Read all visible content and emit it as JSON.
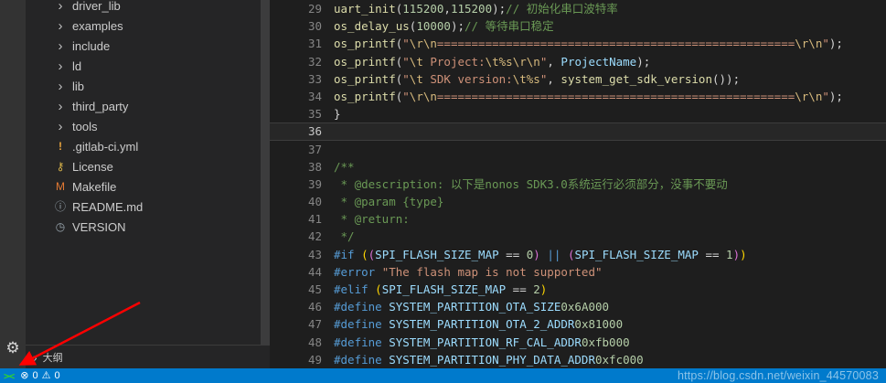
{
  "colors": {
    "statusbar_accent": "#007acc",
    "annotation_arrow": "#ff0000",
    "sidebar_bg": "#252526",
    "editor_bg": "#1e1e1e"
  },
  "icons": {
    "gear": "⚙",
    "chevron": "›"
  },
  "sidebar": {
    "outline_label": "大纲",
    "items": [
      {
        "label": "driver_lib",
        "kind": "folder",
        "icon": "›",
        "icon_name": "chevron-right-icon",
        "icon_color": "#bfbfbf"
      },
      {
        "label": "examples",
        "kind": "folder",
        "icon": "›",
        "icon_name": "chevron-right-icon",
        "icon_color": "#bfbfbf"
      },
      {
        "label": "include",
        "kind": "folder",
        "icon": "›",
        "icon_name": "chevron-right-icon",
        "icon_color": "#bfbfbf"
      },
      {
        "label": "ld",
        "kind": "folder",
        "icon": "›",
        "icon_name": "chevron-right-icon",
        "icon_color": "#bfbfbf"
      },
      {
        "label": "lib",
        "kind": "folder",
        "icon": "›",
        "icon_name": "chevron-right-icon",
        "icon_color": "#bfbfbf"
      },
      {
        "label": "third_party",
        "kind": "folder",
        "icon": "›",
        "icon_name": "chevron-right-icon",
        "icon_color": "#bfbfbf"
      },
      {
        "label": "tools",
        "kind": "folder",
        "icon": "›",
        "icon_name": "chevron-right-icon",
        "icon_color": "#bfbfbf"
      },
      {
        "label": ".gitlab-ci.yml",
        "kind": "file",
        "icon": "!",
        "icon_name": "gitlab-icon",
        "icon_color": "#e8a33d"
      },
      {
        "label": "License",
        "kind": "file",
        "icon": "⚷",
        "icon_name": "license-icon",
        "icon_color": "#d9b44a"
      },
      {
        "label": "Makefile",
        "kind": "file",
        "icon": "M",
        "icon_name": "makefile-icon",
        "icon_color": "#e37933"
      },
      {
        "label": "README.md",
        "kind": "file",
        "icon": "ⓘ",
        "icon_name": "readme-info-icon",
        "icon_color": "#9aa7b0"
      },
      {
        "label": "VERSION",
        "kind": "file",
        "icon": "◷",
        "icon_name": "version-clock-icon",
        "icon_color": "#9aa7b0"
      }
    ]
  },
  "editor": {
    "lines": [
      {
        "num": "29",
        "tokens": [
          {
            "pad": 8
          },
          [
            "uart_init",
            "fn"
          ],
          [
            "(",
            "d"
          ],
          [
            "115200",
            "n"
          ],
          [
            ",",
            "d"
          ],
          [
            "115200",
            "n"
          ],
          [
            ");",
            "d"
          ],
          {
            "pad": 2
          },
          [
            "// 初始化串口波特率",
            "c"
          ]
        ]
      },
      {
        "num": "30",
        "tokens": [
          {
            "pad": 4
          },
          [
            "os_delay_us",
            "fn"
          ],
          [
            "(",
            "d"
          ],
          [
            "10000",
            "n"
          ],
          [
            ");",
            "d"
          ],
          {
            "pad": 11
          },
          [
            "// 等待串口稳定",
            "c"
          ]
        ]
      },
      {
        "num": "31",
        "tokens": [
          {
            "pad": 4
          },
          [
            "os_printf",
            "fn"
          ],
          [
            "(",
            "d"
          ],
          [
            "\"",
            "s"
          ],
          [
            "\\r\\n",
            "e"
          ],
          {
            "rep": "=",
            "n": 52,
            "c": "s"
          },
          [
            "\\r\\n",
            "e"
          ],
          [
            "\"",
            "s"
          ],
          [
            ");",
            "d"
          ]
        ]
      },
      {
        "num": "32",
        "tokens": [
          {
            "pad": 4
          },
          [
            "os_printf",
            "fn"
          ],
          [
            "(",
            "d"
          ],
          [
            "\"",
            "s"
          ],
          [
            "\\t",
            "e"
          ],
          [
            " Project:",
            "s"
          ],
          [
            "\\t",
            "e"
          ],
          [
            "%s",
            "e"
          ],
          [
            "\\r\\n",
            "e"
          ],
          [
            "\"",
            "s"
          ],
          [
            ", ",
            "d"
          ],
          [
            "ProjectName",
            "m"
          ],
          [
            ");",
            "d"
          ]
        ]
      },
      {
        "num": "33",
        "tokens": [
          {
            "pad": 4
          },
          [
            "os_printf",
            "fn"
          ],
          [
            "(",
            "d"
          ],
          [
            "\"",
            "s"
          ],
          [
            "\\t",
            "e"
          ],
          [
            " SDK version:",
            "s"
          ],
          [
            "\\t",
            "e"
          ],
          [
            "%s",
            "e"
          ],
          [
            "\"",
            "s"
          ],
          [
            ", ",
            "d"
          ],
          [
            "system_get_sdk_version",
            "fn"
          ],
          [
            "());",
            "d"
          ]
        ]
      },
      {
        "num": "34",
        "tokens": [
          {
            "pad": 4
          },
          [
            "os_printf",
            "fn"
          ],
          [
            "(",
            "d"
          ],
          [
            "\"",
            "s"
          ],
          [
            "\\r\\n",
            "e"
          ],
          {
            "rep": "=",
            "n": 52,
            "c": "s"
          },
          [
            "\\r\\n",
            "e"
          ],
          [
            "\"",
            "s"
          ],
          [
            ");",
            "d"
          ]
        ]
      },
      {
        "num": "35",
        "tokens": [
          [
            "}",
            "d"
          ]
        ]
      },
      {
        "num": "36",
        "current": true,
        "tokens": []
      },
      {
        "num": "37",
        "tokens": []
      },
      {
        "num": "38",
        "tokens": [
          [
            "/**",
            "c"
          ]
        ]
      },
      {
        "num": "39",
        "tokens": [
          [
            " * @description: 以下是nonos SDK3.0系统运行必须部分，没事不要动",
            "c"
          ]
        ]
      },
      {
        "num": "40",
        "tokens": [
          [
            " * @param {type}",
            "c"
          ]
        ]
      },
      {
        "num": "41",
        "tokens": [
          [
            " * @return:",
            "c"
          ]
        ]
      },
      {
        "num": "42",
        "tokens": [
          [
            " */",
            "c"
          ]
        ]
      },
      {
        "num": "43",
        "tokens": [
          [
            "#if ",
            "p"
          ],
          [
            "(",
            "b1"
          ],
          [
            "(",
            "b2"
          ],
          [
            "SPI_FLASH_SIZE_MAP",
            "m"
          ],
          [
            " == ",
            "d"
          ],
          [
            "0",
            "n"
          ],
          [
            ")",
            "b2"
          ],
          [
            " ",
            "d"
          ],
          [
            "||",
            "p"
          ],
          [
            " ",
            "d"
          ],
          [
            "(",
            "b2"
          ],
          [
            "SPI_FLASH_SIZE_MAP",
            "m"
          ],
          [
            " == ",
            "d"
          ],
          [
            "1",
            "n"
          ],
          [
            ")",
            "b2"
          ],
          [
            ")",
            "b1"
          ]
        ]
      },
      {
        "num": "44",
        "tokens": [
          [
            "#error ",
            "p"
          ],
          [
            "\"The flash map is not supported\"",
            "s"
          ]
        ]
      },
      {
        "num": "45",
        "tokens": [
          [
            "#elif ",
            "p"
          ],
          [
            "(",
            "b1"
          ],
          [
            "SPI_FLASH_SIZE_MAP",
            "m"
          ],
          [
            " == ",
            "d"
          ],
          [
            "2",
            "n"
          ],
          [
            ")",
            "b1"
          ]
        ]
      },
      {
        "num": "46",
        "tokens": [
          [
            "#define ",
            "p"
          ],
          [
            "SYSTEM_PARTITION_OTA_SIZE",
            "m"
          ],
          {
            "pad": 29
          },
          [
            "0x6A000",
            "n"
          ]
        ]
      },
      {
        "num": "47",
        "tokens": [
          [
            "#define ",
            "p"
          ],
          [
            "SYSTEM_PARTITION_OTA_2_ADDR",
            "m"
          ],
          {
            "pad": 27
          },
          [
            "0x81000",
            "n"
          ]
        ]
      },
      {
        "num": "48",
        "tokens": [
          [
            "#define ",
            "p"
          ],
          [
            "SYSTEM_PARTITION_RF_CAL_ADDR",
            "m"
          ],
          {
            "pad": 26
          },
          [
            "0xfb000",
            "n"
          ]
        ]
      },
      {
        "num": "49",
        "tokens": [
          [
            "#define ",
            "p"
          ],
          [
            "SYSTEM_PARTITION_PHY_DATA_ADDR",
            "m"
          ],
          {
            "pad": 24
          },
          [
            "0xfc000",
            "n"
          ]
        ]
      }
    ]
  },
  "status_bar": {
    "remote_icon": "><",
    "error_icon": "⊗",
    "errors": "0",
    "warning_icon": "⚠",
    "warnings": "0",
    "watermark": "https://blog.csdn.net/weixin_44570083"
  }
}
